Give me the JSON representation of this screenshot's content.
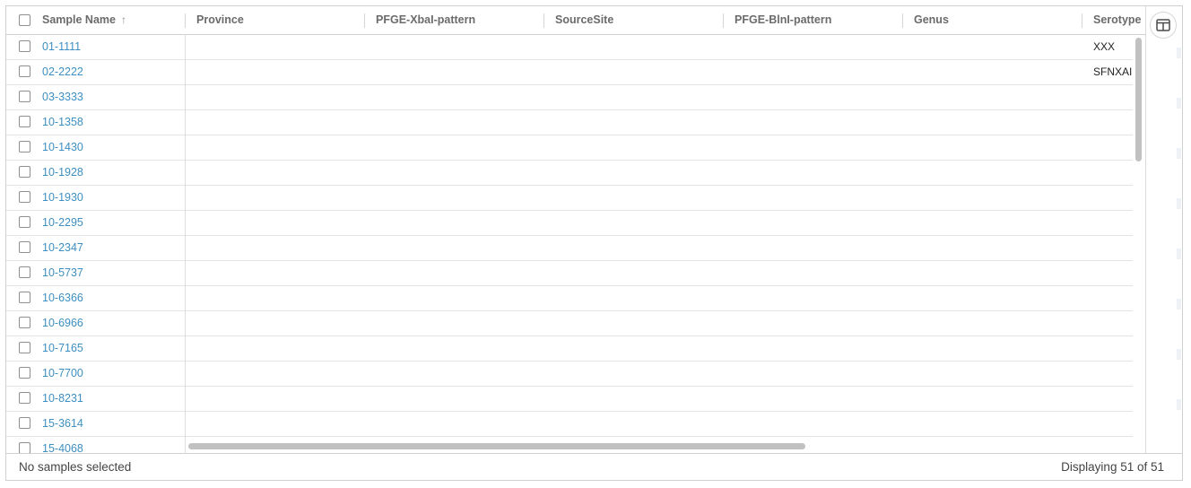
{
  "table": {
    "columns": [
      {
        "label": "Sample Name",
        "sort_indicator": "↑"
      },
      {
        "label": "Province"
      },
      {
        "label": "PFGE-XbaI-pattern"
      },
      {
        "label": "SourceSite"
      },
      {
        "label": "PFGE-BlnI-pattern"
      },
      {
        "label": "Genus"
      },
      {
        "label": "Serotype"
      }
    ],
    "rows": [
      {
        "name": "01-1111",
        "serotype": "XXX"
      },
      {
        "name": "02-2222",
        "serotype": "SFNXAI"
      },
      {
        "name": "03-3333",
        "serotype": ""
      },
      {
        "name": "10-1358",
        "serotype": ""
      },
      {
        "name": "10-1430",
        "serotype": ""
      },
      {
        "name": "10-1928",
        "serotype": ""
      },
      {
        "name": "10-1930",
        "serotype": ""
      },
      {
        "name": "10-2295",
        "serotype": ""
      },
      {
        "name": "10-2347",
        "serotype": ""
      },
      {
        "name": "10-5737",
        "serotype": ""
      },
      {
        "name": "10-6366",
        "serotype": ""
      },
      {
        "name": "10-6966",
        "serotype": ""
      },
      {
        "name": "10-7165",
        "serotype": ""
      },
      {
        "name": "10-7700",
        "serotype": ""
      },
      {
        "name": "10-8231",
        "serotype": ""
      },
      {
        "name": "15-3614",
        "serotype": ""
      },
      {
        "name": "15-4068",
        "serotype": ""
      }
    ]
  },
  "side_panel": {
    "columns_icon": "columns-icon"
  },
  "footer": {
    "selection_text": "No samples selected",
    "count_text": "Displaying 51 of 51"
  },
  "colors": {
    "link": "#3d8fc1",
    "border": "#d0d0d0",
    "scroll_thumb": "#c1c1c1"
  }
}
